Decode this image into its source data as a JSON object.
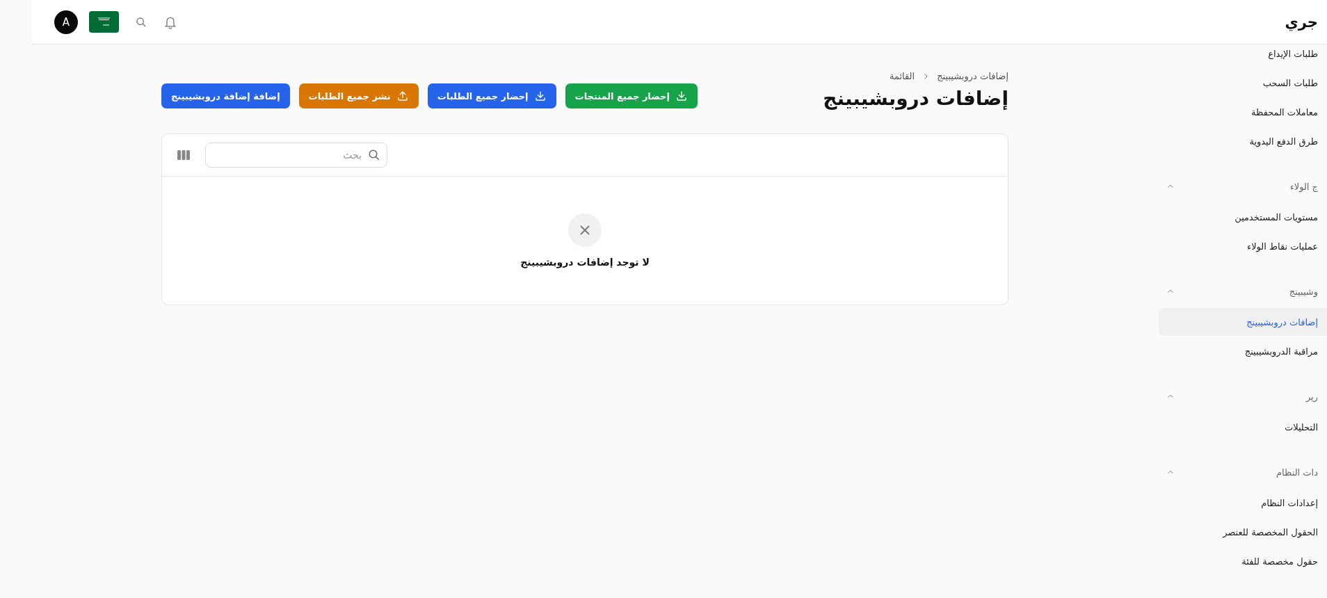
{
  "topbar": {
    "title": "جري",
    "avatar": "A"
  },
  "sidebar": {
    "items": [
      {
        "label": "طلبات الإيداع",
        "selected": false
      },
      {
        "label": "طلبات السحب",
        "selected": false
      },
      {
        "label": "معاملات المحفظة",
        "selected": false
      },
      {
        "label": "طرق الدفع اليدوية",
        "selected": false
      }
    ],
    "groups": [
      {
        "label": "ج الولاء",
        "expanded": true,
        "children": [
          {
            "label": "مستويات المستخدمين",
            "selected": false
          },
          {
            "label": "عمليات نقاط الولاء",
            "selected": false
          }
        ]
      },
      {
        "label": "وشيبينج",
        "expanded": true,
        "children": [
          {
            "label": "إضافات دروبشيبينج",
            "selected": true
          },
          {
            "label": "مراقبة الدروبشيبينج",
            "selected": false
          }
        ]
      },
      {
        "label": "رير",
        "expanded": true,
        "children": [
          {
            "label": "التحليلات",
            "selected": false
          }
        ]
      },
      {
        "label": "دات النظام",
        "expanded": true,
        "children": [
          {
            "label": "إعدادات النظام",
            "selected": false
          },
          {
            "label": "الحقول المخصصة للعنصر",
            "selected": false
          },
          {
            "label": "حقول مخصصة للفئة",
            "selected": false
          }
        ]
      }
    ]
  },
  "breadcrumb": [
    "إضافات دروبشيبينج",
    "القائمة"
  ],
  "page_title": "إضافات دروبشيبينج",
  "actions": [
    {
      "label": "إحضار جميع المنتجات",
      "kind": "download",
      "color": "#16a34a"
    },
    {
      "label": "إحضار جميع الطلبات",
      "kind": "download",
      "color": "#2563eb"
    },
    {
      "label": "نشر جميع الطلبات",
      "kind": "upload",
      "color": "#d97706"
    },
    {
      "label": "إضافة إضافة دروبشيبينج",
      "kind": "plain",
      "color": "#2563eb"
    }
  ],
  "table": {
    "search": {
      "placeholder": "بحث"
    },
    "empty_message": "لا توجد إضافات دروبشيبينج"
  }
}
